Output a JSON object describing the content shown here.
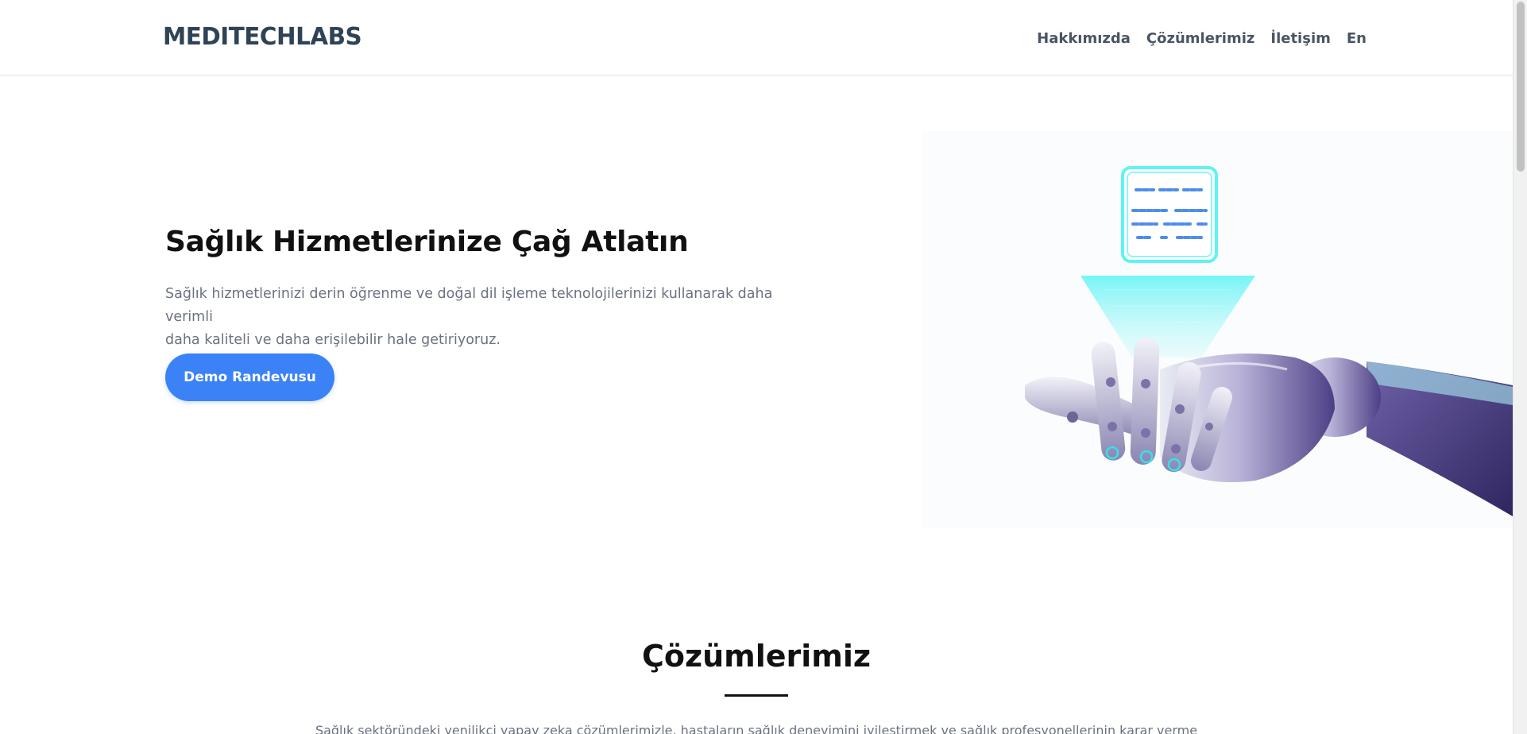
{
  "header": {
    "logo_text": "MEDITECHLABS",
    "nav": [
      {
        "label": "Hakkımızda"
      },
      {
        "label": "Çözümlerimiz"
      },
      {
        "label": "İletişim"
      },
      {
        "label": "En"
      }
    ]
  },
  "hero": {
    "title": "Sağlık Hizmetlerinize Çağ Atlatın",
    "text_line1": "Sağlık hizmetlerinizi derin öğrenme ve doğal dil işleme teknolojilerinizi kullanarak daha verimli",
    "text_line2": "daha kaliteli ve daha erişilebilir hale getiriyoruz.",
    "cta_label": "Demo Randevusu"
  },
  "solutions": {
    "title": "Çözümlerimiz",
    "text": "Sağlık sektöründeki yenilikçi yapay zeka çözümlerimizle, hastaların sağlık deneyimini iyileştirmek ve sağlık profesyonellerinin karar verme"
  },
  "colors": {
    "accent": "#3b82f6",
    "logo": "#2f4356",
    "nav_text": "#4a5563",
    "body_text": "#6b7280",
    "cyan_glow": "#5ff3f5"
  },
  "icons": {
    "hero_illustration": "robot-hand-hologram-icon"
  }
}
